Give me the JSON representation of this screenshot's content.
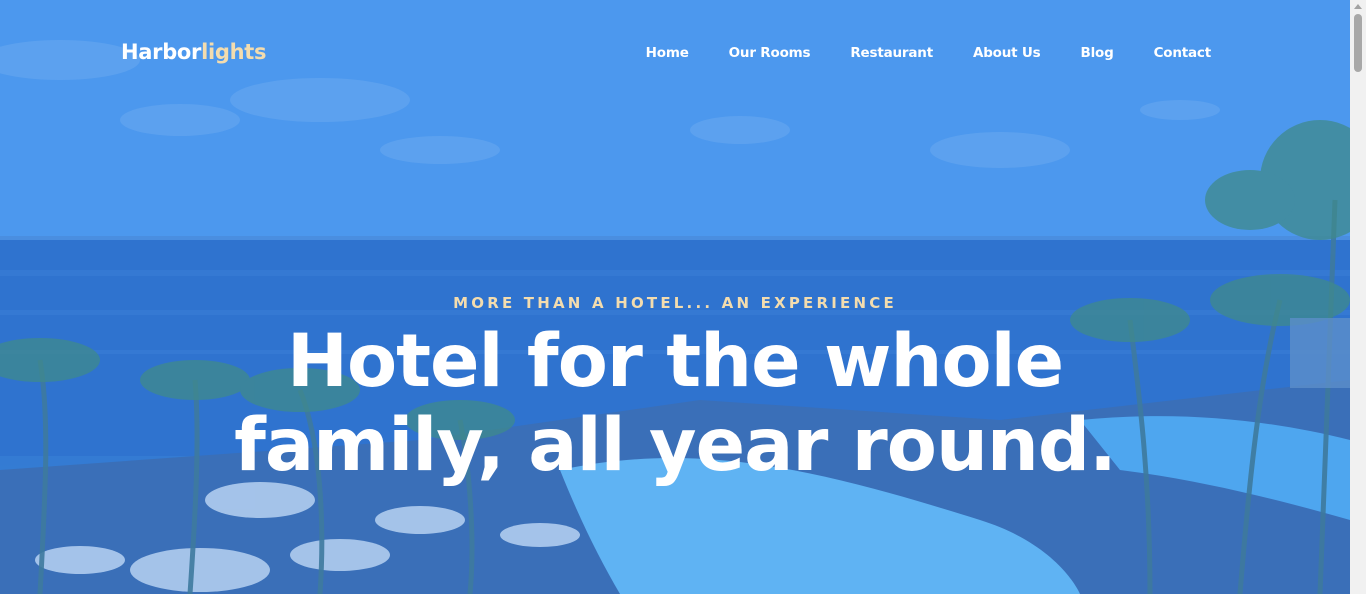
{
  "brand": {
    "name_main": "Harbor",
    "name_accent": "lights"
  },
  "nav": {
    "items": [
      {
        "label": "Home"
      },
      {
        "label": "Our Rooms"
      },
      {
        "label": "Restaurant"
      },
      {
        "label": "About Us"
      },
      {
        "label": "Blog"
      },
      {
        "label": "Contact"
      }
    ]
  },
  "hero": {
    "eyebrow": "MORE THAN A HOTEL... AN EXPERIENCE",
    "headline_line1": "Hotel for the whole",
    "headline_line2": "family, all year round."
  },
  "colors": {
    "overlay": "#3d8be0",
    "accent": "#f3dcae",
    "text": "#ffffff"
  }
}
